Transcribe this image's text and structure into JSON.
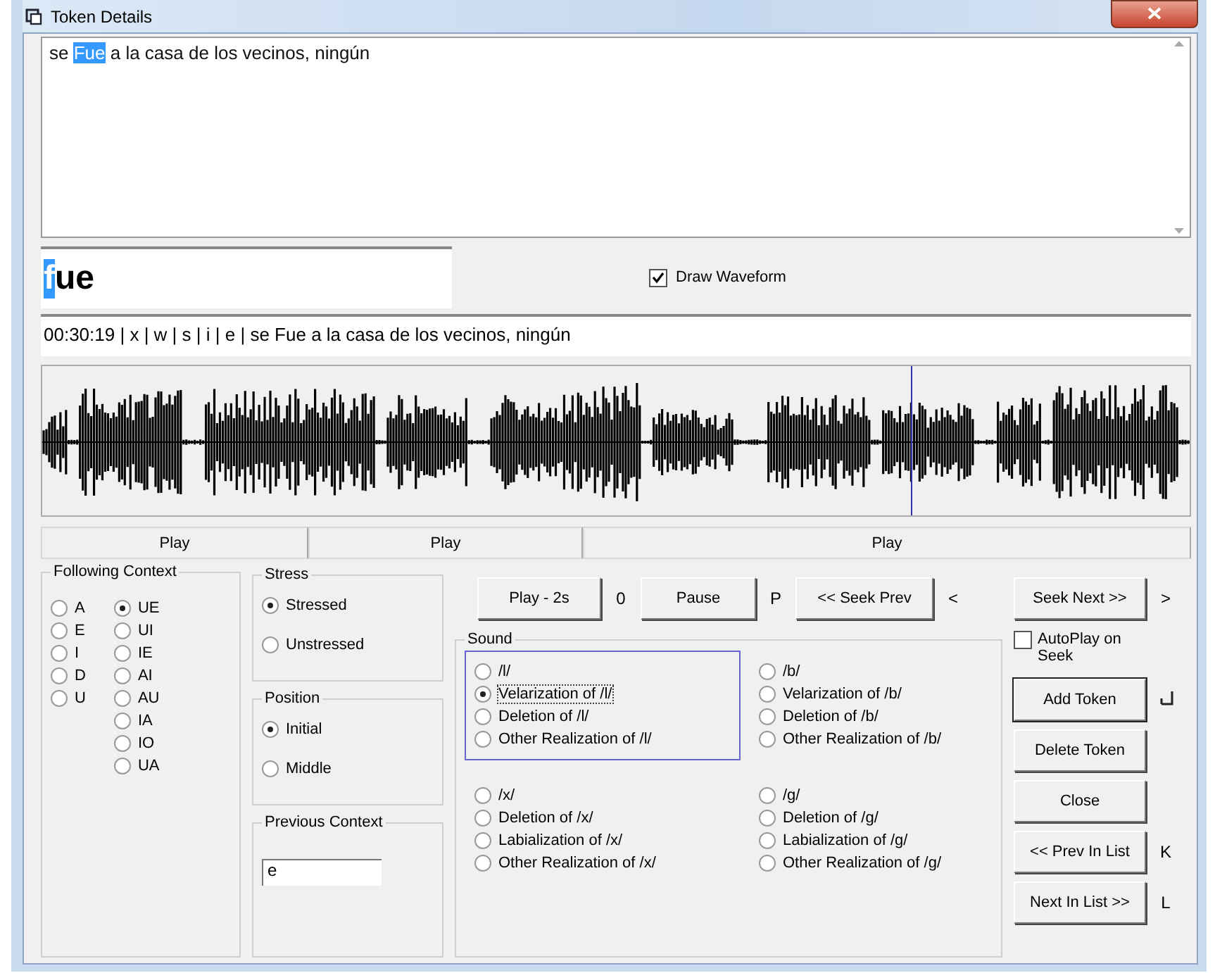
{
  "window": {
    "title": "Token Details"
  },
  "transcript": {
    "segments": [
      {
        "text": "se ",
        "selected": false
      },
      {
        "text": "Fue",
        "selected": true
      },
      {
        "text": " a la casa de los vecinos, ningún",
        "selected": false
      }
    ]
  },
  "token_field": {
    "segments": [
      {
        "text": "f",
        "selected": true
      },
      {
        "text": "ue",
        "selected": false
      }
    ]
  },
  "draw_waveform": {
    "label": "Draw Waveform",
    "checked": true
  },
  "context_line": "00:30:19 | x | w | s | i | e |  se Fue a la casa de los vecinos, ningún",
  "waveform": {
    "playhead": {
      "level": 0.757
    }
  },
  "play_buttons": [
    "Play",
    "Play",
    "Play"
  ],
  "following_context": {
    "title": "Following Context",
    "columns": [
      [
        {
          "label": "A",
          "selected": false
        },
        {
          "label": "E",
          "selected": false
        },
        {
          "label": "I",
          "selected": false
        },
        {
          "label": "D",
          "selected": false
        },
        {
          "label": "U",
          "selected": false
        }
      ],
      [
        {
          "label": "UE",
          "selected": true
        },
        {
          "label": "UI",
          "selected": false
        },
        {
          "label": "IE",
          "selected": false
        },
        {
          "label": "AI",
          "selected": false
        },
        {
          "label": "AU",
          "selected": false
        },
        {
          "label": "IA",
          "selected": false
        },
        {
          "label": "IO",
          "selected": false
        },
        {
          "label": "UA",
          "selected": false
        }
      ]
    ]
  },
  "stress": {
    "title": "Stress",
    "options": [
      {
        "label": "Stressed",
        "selected": true
      },
      {
        "label": "Unstressed",
        "selected": false
      }
    ]
  },
  "position": {
    "title": "Position",
    "options": [
      {
        "label": "Initial",
        "selected": true
      },
      {
        "label": "Middle",
        "selected": false
      }
    ]
  },
  "previous_context": {
    "title": "Previous Context",
    "value": "e"
  },
  "transport": [
    {
      "label": "Play - 2s",
      "hotkey": "0"
    },
    {
      "label": "Pause",
      "hotkey": "P"
    },
    {
      "label": "<< Seek Prev",
      "hotkey": "<"
    }
  ],
  "sound": {
    "title": "Sound",
    "groups": [
      {
        "focused": true,
        "options": [
          {
            "label": "/l/",
            "selected": false
          },
          {
            "label": "Velarization of /l/",
            "selected": true
          },
          {
            "label": "Deletion of /l/",
            "selected": false
          },
          {
            "label": "Other Realization of /l/",
            "selected": false
          }
        ]
      },
      {
        "focused": false,
        "options": [
          {
            "label": "/b/",
            "selected": false
          },
          {
            "label": "Velarization of /b/",
            "selected": false
          },
          {
            "label": "Deletion of /b/",
            "selected": false
          },
          {
            "label": "Other Realization of /b/",
            "selected": false
          }
        ]
      },
      {
        "focused": false,
        "options": [
          {
            "label": "/x/",
            "selected": false
          },
          {
            "label": "Deletion of /x/",
            "selected": false
          },
          {
            "label": "Labialization of /x/",
            "selected": false
          },
          {
            "label": "Other Realization of /x/",
            "selected": false
          }
        ]
      },
      {
        "focused": false,
        "options": [
          {
            "label": "/g/",
            "selected": false
          },
          {
            "label": "Deletion of /g/",
            "selected": false
          },
          {
            "label": "Labialization of /g/",
            "selected": false
          },
          {
            "label": "Other Realization of /g/",
            "selected": false
          }
        ]
      }
    ]
  },
  "seek_next": {
    "label": "Seek Next >>",
    "hotkey": ">"
  },
  "autoplay": {
    "label": "AutoPlay on Seek",
    "checked": false
  },
  "actions": [
    {
      "label": "Add Token",
      "kind": "enter",
      "default": true
    },
    {
      "label": "Delete Token",
      "kind": "plain",
      "default": false
    },
    {
      "label": "Close",
      "kind": "plain",
      "default": false
    },
    {
      "label": "<< Prev In List",
      "kind": "key",
      "hotkey": "K",
      "default": false
    },
    {
      "label": "Next In List >>",
      "kind": "key",
      "hotkey": "L",
      "default": false
    }
  ]
}
